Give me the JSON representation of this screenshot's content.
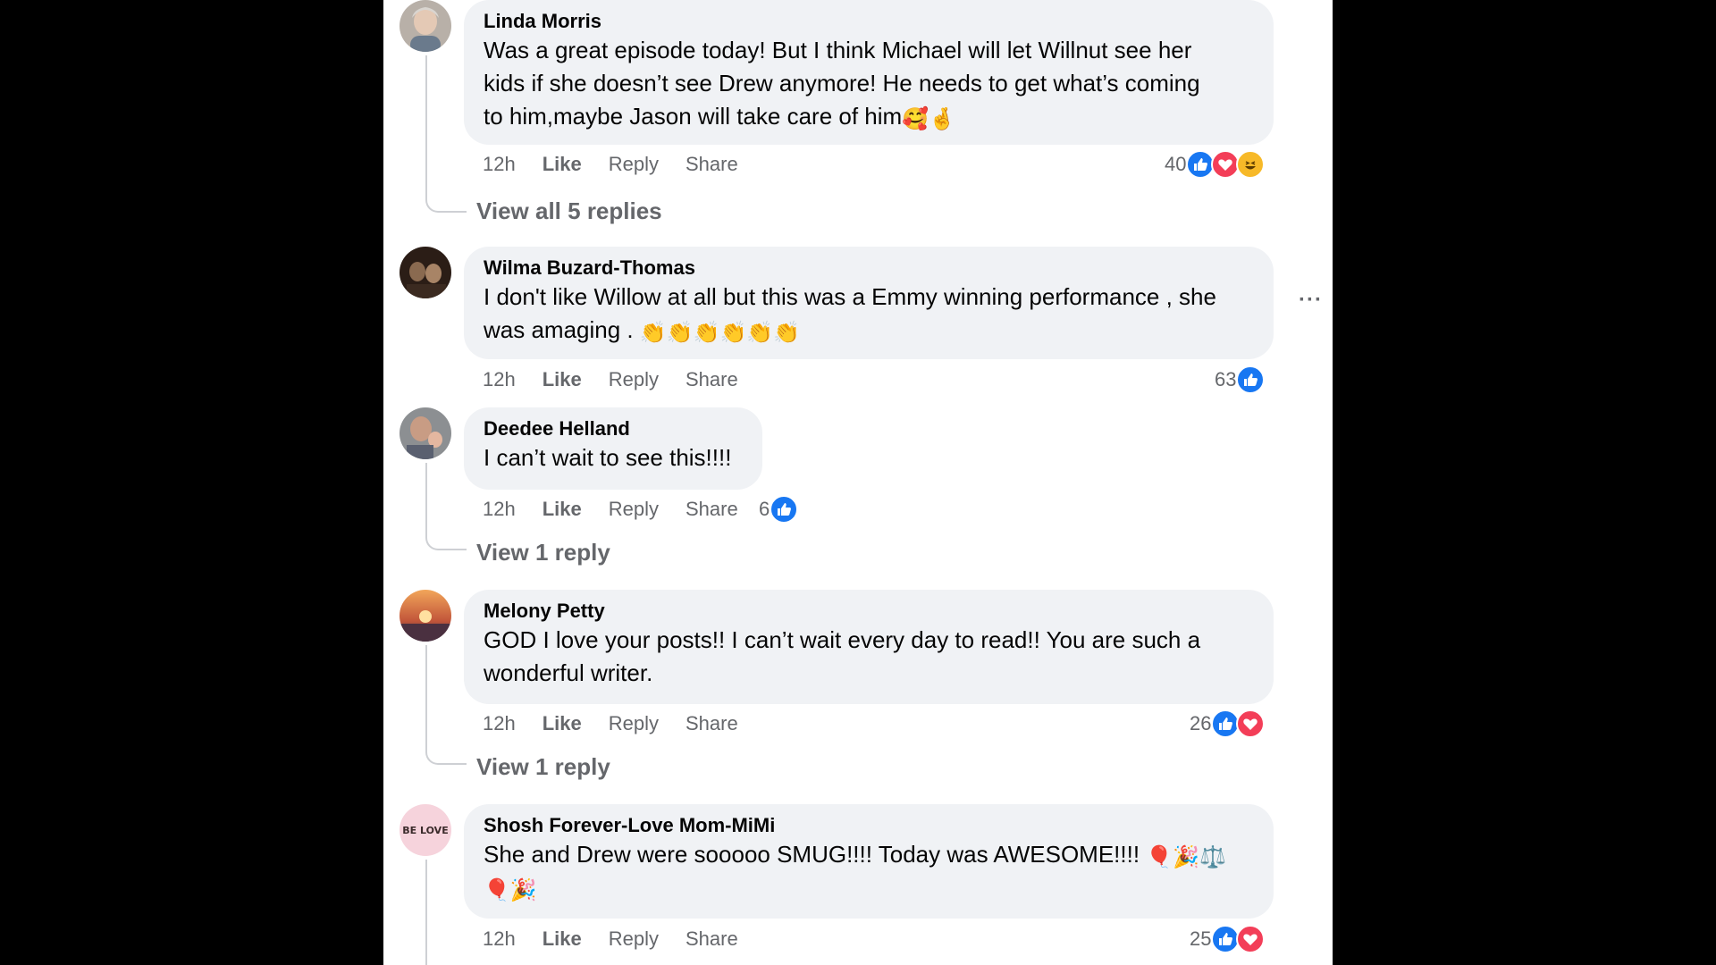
{
  "comments": [
    {
      "author": "Linda Morris",
      "text_lines": [
        "Was a great episode today! But I think Michael will let Willnut see her",
        "kids if she doesn’t see Drew anymore! He needs to get what’s coming",
        "to him,maybe Jason will take care of him"
      ],
      "emojis": "🥰🤞",
      "time": "12h",
      "like": "Like",
      "reply": "Reply",
      "share": "Share",
      "reaction_count": "40",
      "reactions": [
        "like-icon",
        "love-icon",
        "haha-icon"
      ],
      "view_replies": "View all 5 replies"
    },
    {
      "author": "Wilma Buzard-Thomas",
      "text_lines": [
        "I don't like Willow at all but this was a Emmy winning performance , she",
        "was amaging . "
      ],
      "emojis": "👏👏👏👏👏👏",
      "time": "12h",
      "like": "Like",
      "reply": "Reply",
      "share": "Share",
      "reaction_count": "63",
      "reactions": [
        "like-icon"
      ],
      "more": "···"
    },
    {
      "author": "Deedee Helland",
      "text_lines": [
        "I can’t wait to see this!!!!"
      ],
      "time": "12h",
      "like": "Like",
      "reply": "Reply",
      "share": "Share",
      "reaction_count": "6",
      "reactions": [
        "like-icon"
      ],
      "view_replies": "View 1 reply"
    },
    {
      "author": "Melony Petty",
      "text_lines": [
        "GOD I love your posts!! I can’t wait every day to read!! You are such a",
        "wonderful writer."
      ],
      "time": "12h",
      "like": "Like",
      "reply": "Reply",
      "share": "Share",
      "reaction_count": "26",
      "reactions": [
        "like-icon",
        "love-icon"
      ],
      "view_replies": "View 1 reply"
    },
    {
      "author": "Shosh Forever-Love Mom-MiMi",
      "avatar_text": "BE LOVE",
      "text_lines": [
        "She and Drew were sooooo SMUG!!!! Today was AWESOME!!!! ",
        ""
      ],
      "emojis_line1": "🎈🎉⚖️",
      "emojis_line2": "🎈🎉",
      "time": "12h",
      "like": "Like",
      "reply": "Reply",
      "share": "Share",
      "reaction_count": "25",
      "reactions": [
        "like-icon",
        "love-icon"
      ]
    }
  ],
  "colors": {
    "background": "#000000",
    "panel": "#ffffff",
    "bubble": "#f0f2f5",
    "secondary_text": "#65676b",
    "like_blue": "#1877f2",
    "love_red": "#f33e58",
    "haha_yellow": "#f7b928"
  }
}
